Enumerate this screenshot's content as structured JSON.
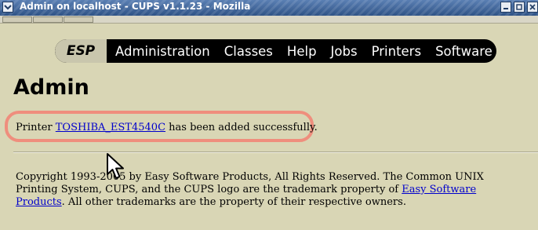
{
  "window": {
    "title": "Admin on localhost - CUPS v1.1.23 - Mozilla",
    "menu_icon": "chevron-down-icon",
    "controls": [
      "minimize-icon",
      "maximize-icon",
      "close-icon"
    ]
  },
  "nav": {
    "logo": "ESP",
    "items": [
      "Administration",
      "Classes",
      "Help",
      "Jobs",
      "Printers",
      "Software"
    ]
  },
  "page": {
    "title": "Admin",
    "message_prefix": "Printer ",
    "printer_link": "TOSHIBA_EST4540C",
    "message_suffix": " has been added successfully."
  },
  "footer": {
    "text_1": "Copyright 1993-2005 by Easy Software Products, All Rights Reserved. The Common UNIX Printing System, CUPS, and the CUPS logo are the trademark property of ",
    "link": "Easy Software Products",
    "text_2": ". All other trademarks are the property of their respective owners."
  },
  "colors": {
    "content_bg": "#d9d6b5",
    "navbar_bg": "#000000",
    "link": "#0000cc",
    "highlight": "#ef8e7d",
    "titlebar": "#3b5f91"
  }
}
